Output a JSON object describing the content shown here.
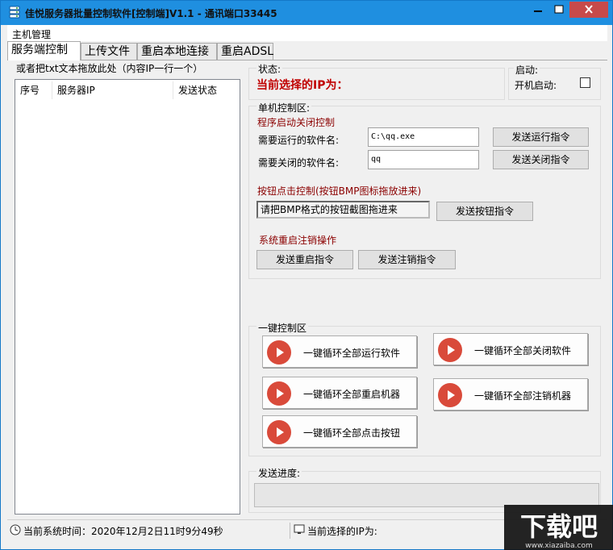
{
  "window": {
    "title": "佳悦服务器批量控制软件[控制端]V1.1 - 通讯端口33445"
  },
  "menu": {
    "host_manage": "主机管理"
  },
  "tabs": [
    {
      "label": "服务端控制"
    },
    {
      "label": "上传文件"
    },
    {
      "label": "重启本地连接"
    },
    {
      "label": "重启ADSL"
    }
  ],
  "left": {
    "drop_hint": "或者把txt文本拖放此处（内容IP一行一个）",
    "columns": [
      "序号",
      "服务器IP",
      "发送状态"
    ]
  },
  "status": {
    "label": "状态:",
    "current_ip": "当前选择的IP为："
  },
  "startup": {
    "label": "启动:",
    "boot_label": "开机启动:",
    "checked": false
  },
  "single": {
    "label": "单机控制区:",
    "program_section": "程序启动关闭控制",
    "run_label": "需要运行的软件名:",
    "run_value": "C:\\qq.exe",
    "run_button": "发送运行指令",
    "close_label": "需要关闭的软件名:",
    "close_value": "qq",
    "close_button": "发送关闭指令",
    "button_section": "按钮点击控制(按钮BMP图标拖放进来)",
    "bmp_placeholder": "请把BMP格式的按钮截图拖进来",
    "send_button": "发送按钮指令",
    "restart_section": "系统重启注销操作",
    "restart_button": "发送重启指令",
    "logout_button": "发送注销指令"
  },
  "onekey": {
    "label": "一键控制区",
    "run_all": "一键循环全部运行软件",
    "close_all": "一键循环全部关闭软件",
    "restart_all": "一键循环全部重启机器",
    "logout_all": "一键循环全部注销机器",
    "click_all": "一键循环全部点击按钮"
  },
  "progress": {
    "label": "发送进度:",
    "value": 0
  },
  "statusbar": {
    "time": "当前系统时间：2020年12月2日11时9分49秒",
    "ip": "当前选择的IP为:"
  },
  "watermark": {
    "text": "下载吧",
    "url": "www.xiazaiba.com"
  },
  "colors": {
    "titlebar": "#1f8fe0",
    "accent_red": "#c00000",
    "section_red": "#8b0000"
  }
}
